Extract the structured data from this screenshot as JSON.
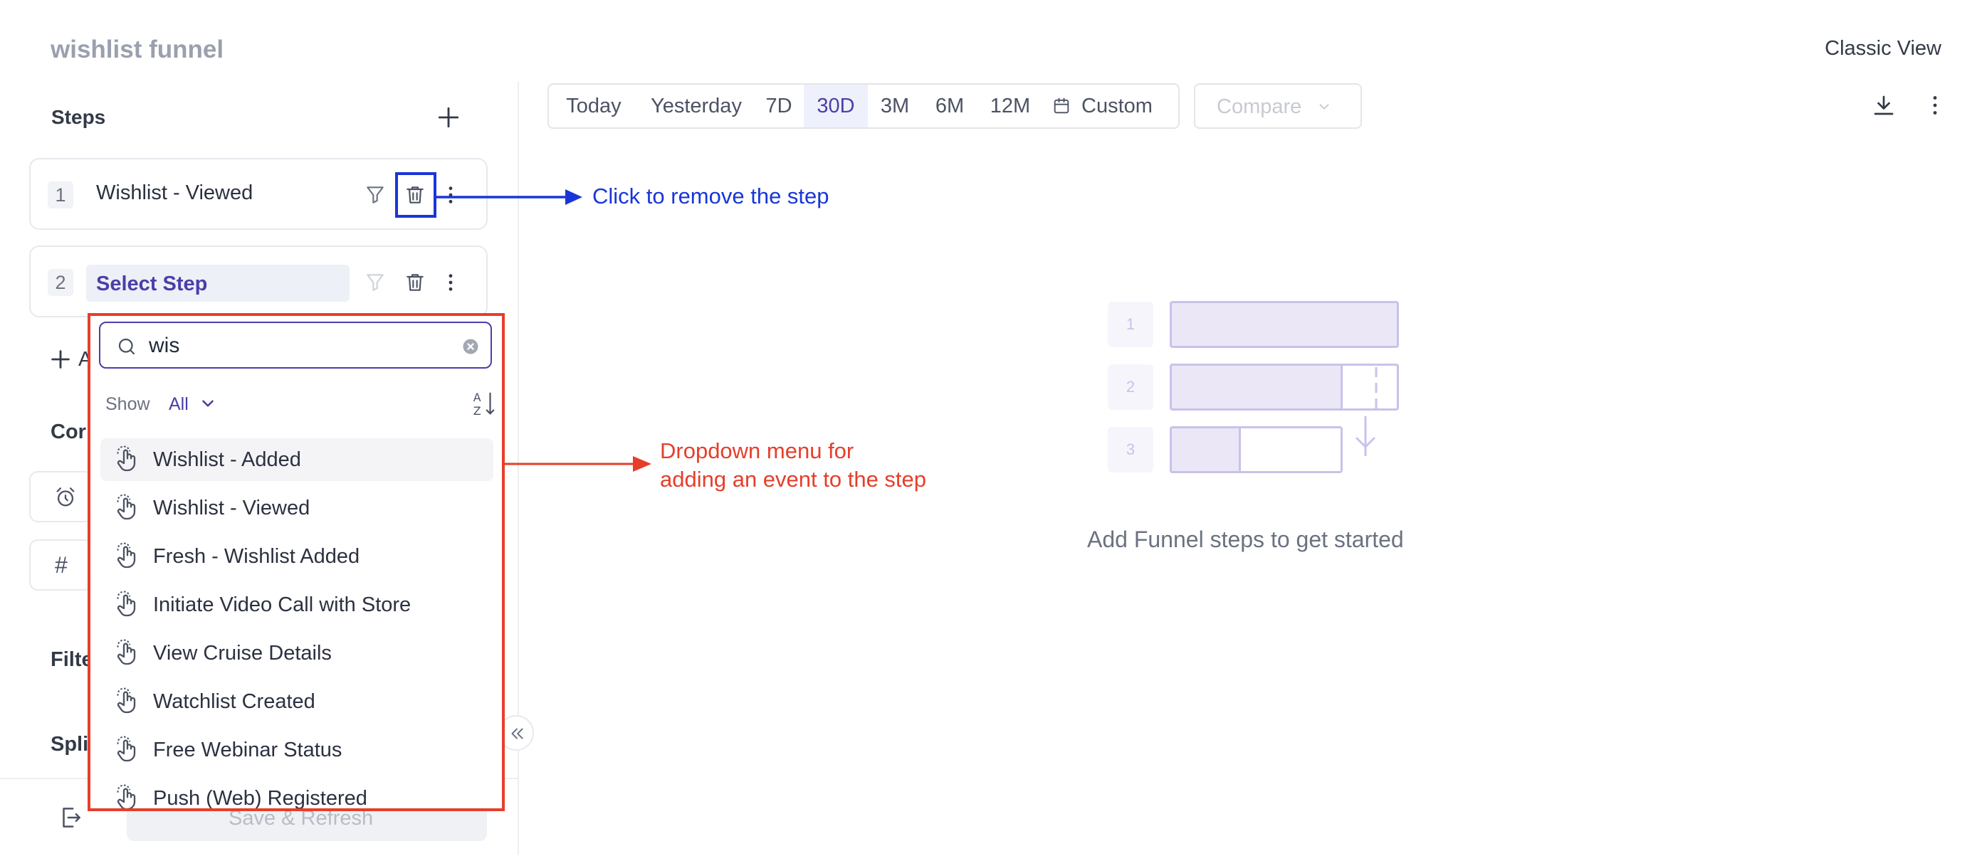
{
  "header": {
    "title": "wishlist funnel",
    "classic_view": "Classic View"
  },
  "sidebar": {
    "steps_label": "Steps",
    "steps": [
      {
        "number": "1",
        "name": "Wishlist - Viewed"
      },
      {
        "number": "2",
        "name": "Select Step"
      }
    ],
    "add_step_fragment": "A",
    "conversion_fragment": "Cor",
    "filters_fragment": "Filte",
    "split_fragment": "Spli",
    "hash_symbol": "#",
    "save_label": "Save & Refresh"
  },
  "dropdown": {
    "search_value": "wis",
    "show_label": "Show",
    "show_value": "All",
    "items": [
      "Wishlist - Added",
      "Wishlist - Viewed",
      "Fresh - Wishlist Added",
      "Initiate Video Call with Store",
      "View Cruise Details",
      "Watchlist Created",
      "Free Webinar Status",
      "Push (Web) Registered"
    ]
  },
  "toolbar": {
    "ranges": [
      "Today",
      "Yesterday",
      "7D",
      "30D",
      "3M",
      "6M",
      "12M",
      "Custom"
    ],
    "active_range": "30D",
    "compare_label": "Compare"
  },
  "empty_state": {
    "row_numbers": [
      "1",
      "2",
      "3"
    ],
    "message": "Add Funnel steps to get started"
  },
  "annotations": {
    "remove_step": "Click to remove the step",
    "dropdown_line1": "Dropdown menu for",
    "dropdown_line2": "adding an event to the step"
  },
  "colors": {
    "accent": "#4a3fa8",
    "annotation_blue": "#1836d8",
    "annotation_red": "#e63e2a",
    "funnel_fill": "#ebe7f7",
    "funnel_stroke": "#c9c2ea"
  },
  "icons": [
    "plus-icon",
    "filter-icon",
    "trash-icon",
    "more-vertical-icon",
    "search-icon",
    "clear-icon",
    "chevron-down-icon",
    "sort-az-icon",
    "hand-pointer-icon",
    "calendar-icon",
    "download-icon",
    "collapse-icon",
    "alarm-icon",
    "logout-icon",
    "refresh-icon"
  ]
}
